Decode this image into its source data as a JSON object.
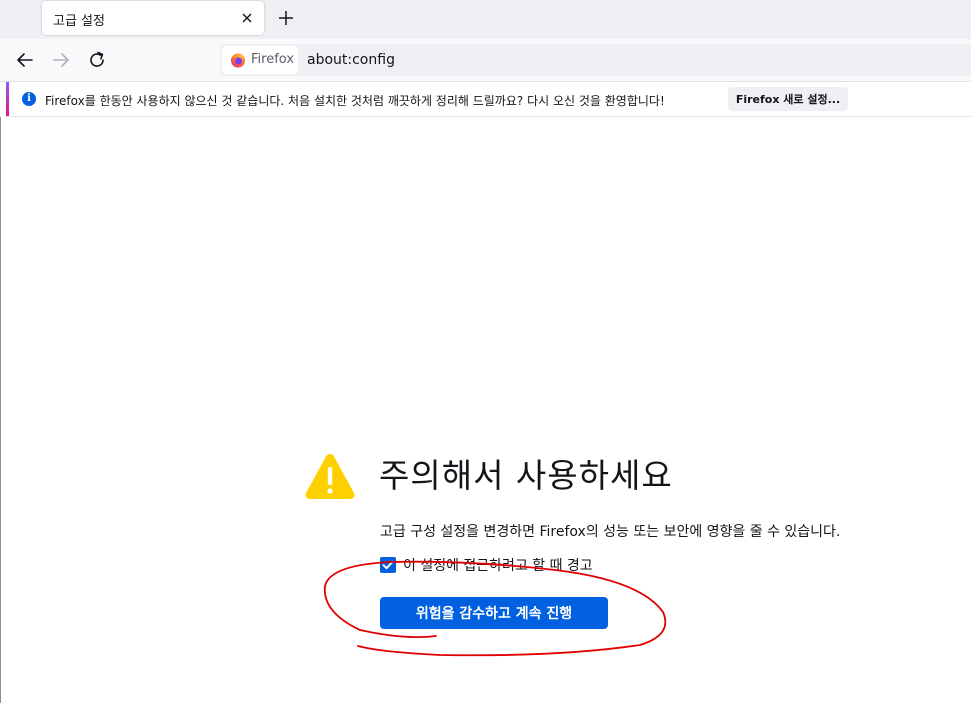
{
  "tab": {
    "title": "고급 설정"
  },
  "navbar": {
    "identity_label": "Firefox",
    "url": "about:config"
  },
  "notification": {
    "message": "Firefox를 한동안 사용하지 않으신 것 같습니다. 처음 설치한 것처럼 깨끗하게 정리해 드릴까요? 다시 오신 것을 환영합니다!",
    "button_label": "Firefox 새로 설정..."
  },
  "warning": {
    "title": "주의해서 사용하세요",
    "description": "고급 구성 설정을 변경하면 Firefox의 성능 또는 보안에 영향을 줄 수 있습니다.",
    "checkbox_label": "이 설정에 접근하려고 할 때 경고",
    "checkbox_checked": true,
    "accept_button": "위험을 감수하고 계속 진행"
  },
  "colors": {
    "accent": "#0060df",
    "warning_icon": "#ffd000",
    "annotation": "#e00000"
  },
  "icons": [
    "close-icon",
    "plus-icon",
    "back-arrow-icon",
    "forward-arrow-icon",
    "reload-icon",
    "firefox-logo-icon",
    "info-icon",
    "warning-triangle-icon",
    "checkmark-icon"
  ]
}
